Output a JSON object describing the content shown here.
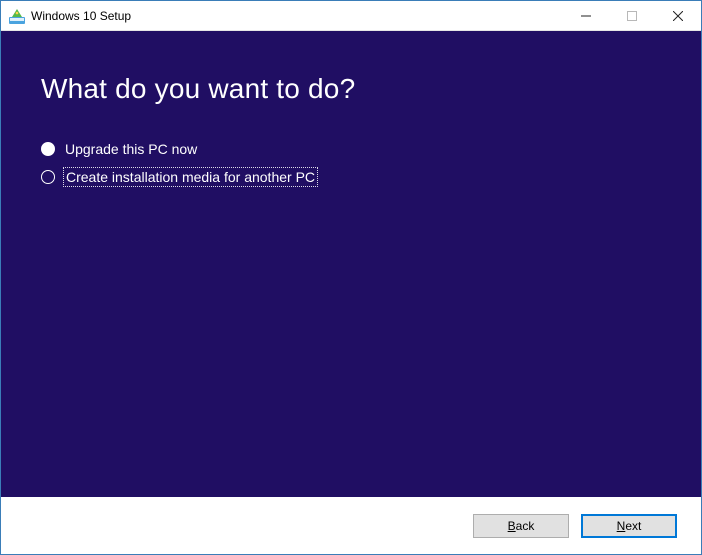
{
  "titlebar": {
    "title": "Windows 10 Setup"
  },
  "main": {
    "heading": "What do you want to do?",
    "options": [
      {
        "label": "Upgrade this PC now",
        "selected": false
      },
      {
        "label": "Create installation media for another PC",
        "selected": true
      }
    ]
  },
  "footer": {
    "back": {
      "prefix": "",
      "accel": "B",
      "rest": "ack"
    },
    "next": {
      "prefix": "",
      "accel": "N",
      "rest": "ext"
    }
  }
}
